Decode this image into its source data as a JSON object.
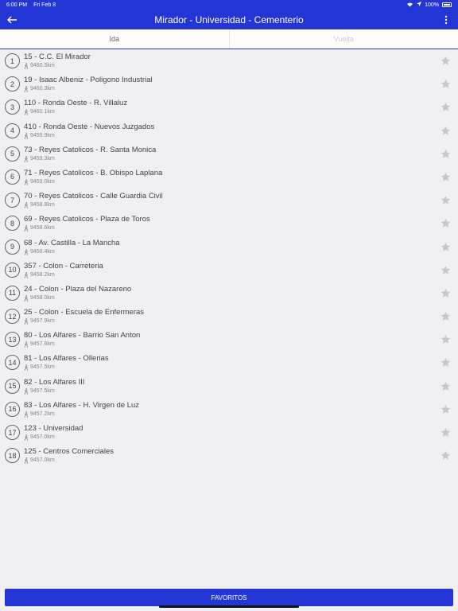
{
  "status": {
    "time": "6:00 PM",
    "date": "Fri Feb 8",
    "battery": "100%"
  },
  "header": {
    "title": "Mirador - Universidad - Cementerio",
    "back_icon": "back-arrow-icon",
    "menu_icon": "more-vert-icon"
  },
  "tabs": [
    {
      "label": "Ida",
      "active": true
    },
    {
      "label": "Vuelta",
      "active": false
    }
  ],
  "stops": [
    {
      "num": "1",
      "name": "15 - C.C. El Mirador",
      "dist": "9460.5km"
    },
    {
      "num": "2",
      "name": "19 - Isaac Albeniz - Poligono Industrial",
      "dist": "9460.3km"
    },
    {
      "num": "3",
      "name": "110 - Ronda Oeste - R. Villaluz",
      "dist": "9460.1km"
    },
    {
      "num": "4",
      "name": "410 - Ronda Oeste - Nuevos Juzgados",
      "dist": "9459.9km"
    },
    {
      "num": "5",
      "name": "73 - Reyes Catolicos - R. Santa Monica",
      "dist": "9459.3km"
    },
    {
      "num": "6",
      "name": "71 - Reyes Catolicos - B. Obispo Laplana",
      "dist": "9459.0km"
    },
    {
      "num": "7",
      "name": "70 - Reyes Catolicos - Calle Guardia Civil",
      "dist": "9458.8km"
    },
    {
      "num": "8",
      "name": "69 - Reyes Catolicos - Plaza de Toros",
      "dist": "9458.6km"
    },
    {
      "num": "9",
      "name": "68 - Av. Castilla - La Mancha",
      "dist": "9458.4km"
    },
    {
      "num": "10",
      "name": "357 - Colon - Carreteria",
      "dist": "9458.2km"
    },
    {
      "num": "11",
      "name": "24 - Colon - Plaza del Nazareno",
      "dist": "9458.0km"
    },
    {
      "num": "12",
      "name": "25 - Colon - Escuela de Enfermeras",
      "dist": "9457.9km"
    },
    {
      "num": "13",
      "name": "80 - Los Alfares - Barrio San Anton",
      "dist": "9457.6km"
    },
    {
      "num": "14",
      "name": "81 - Los Alfares - Ollerias",
      "dist": "9457.5km"
    },
    {
      "num": "15",
      "name": "82 - Los  Alfares III",
      "dist": "9457.5km"
    },
    {
      "num": "16",
      "name": "83 - Los Alfares - H. Virgen de Luz",
      "dist": "9457.2km"
    },
    {
      "num": "17",
      "name": "123 - Universidad",
      "dist": "9457.0km"
    },
    {
      "num": "18",
      "name": "125 - Centros Comerciales",
      "dist": "9457.0km"
    }
  ],
  "footer": {
    "favorites_label": "FAVORITOS"
  },
  "colors": {
    "primary": "#2435d6",
    "star": "#c8c8c8"
  }
}
